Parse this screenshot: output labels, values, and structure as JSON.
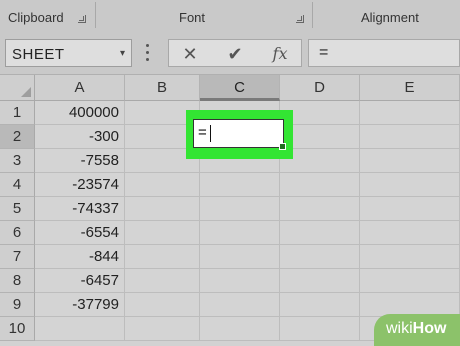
{
  "ribbon": {
    "groups": [
      {
        "label": "Clipboard"
      },
      {
        "label": "Font"
      },
      {
        "label": "Alignment"
      }
    ]
  },
  "formula_bar": {
    "name_box": "SHEET",
    "cancel_icon": "x-icon",
    "enter_icon": "check-icon",
    "fx_label": "fx",
    "formula": "="
  },
  "columns": [
    "A",
    "B",
    "C",
    "D",
    "E"
  ],
  "rows": [
    {
      "num": "1",
      "a": "400000"
    },
    {
      "num": "2",
      "a": "-300"
    },
    {
      "num": "3",
      "a": "-7558"
    },
    {
      "num": "4",
      "a": "-23574"
    },
    {
      "num": "5",
      "a": "-74337"
    },
    {
      "num": "6",
      "a": "-6554"
    },
    {
      "num": "7",
      "a": "-844"
    },
    {
      "num": "8",
      "a": "-6457"
    },
    {
      "num": "9",
      "a": "-37799"
    },
    {
      "num": "10",
      "a": ""
    }
  ],
  "active_cell": {
    "ref": "C2",
    "content": "="
  },
  "watermark": {
    "wiki": "wiki",
    "how": "How"
  },
  "colors": {
    "highlight": "#33e533",
    "watermark": "#8cc26a"
  }
}
